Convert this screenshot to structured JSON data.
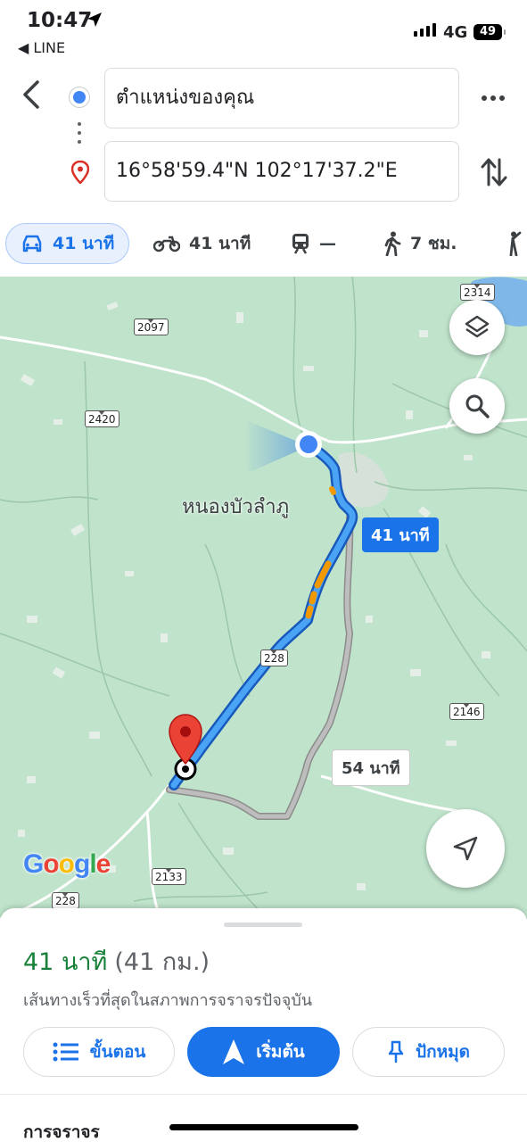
{
  "status_bar": {
    "time": "10:47",
    "back_app": "◀ LINE",
    "network": "4G",
    "battery": "49"
  },
  "directions": {
    "origin": "ตำแหน่งของคุณ",
    "destination": "16°58'59.4\"N 102°17'37.2\"E"
  },
  "modes": [
    {
      "icon": "car-icon",
      "label": "41 นาที",
      "selected": true
    },
    {
      "icon": "motorcycle-icon",
      "label": "41 นาที"
    },
    {
      "icon": "train-icon",
      "label": "—"
    },
    {
      "icon": "walk-icon",
      "label": "7 ชม."
    },
    {
      "icon": "ride-hail-icon",
      "label": ""
    }
  ],
  "map": {
    "place_label": "หนองบัวลำภู",
    "route_shields": [
      "2314",
      "2097",
      "2420",
      "228",
      "2146",
      "2133",
      "228"
    ],
    "primary_route_label": "41 นาที",
    "alt_route_label": "54 นาที",
    "logo": "Google",
    "colors": {
      "route": "#1a73e8",
      "alt_route": "#a8a8a8",
      "traffic_slow": "#f29900",
      "land": "#bfe3cb"
    }
  },
  "sheet": {
    "duration": "41 นาที",
    "distance": "(41 กม.)",
    "subtitle": "เส้นทางเร็วที่สุดในสภาพการจราจรปัจจุบัน",
    "steps_button": "ขั้นตอน",
    "start_button": "เริ่มต้น",
    "pin_button": "ปักหมุด",
    "traffic_heading": "การจราจร"
  }
}
